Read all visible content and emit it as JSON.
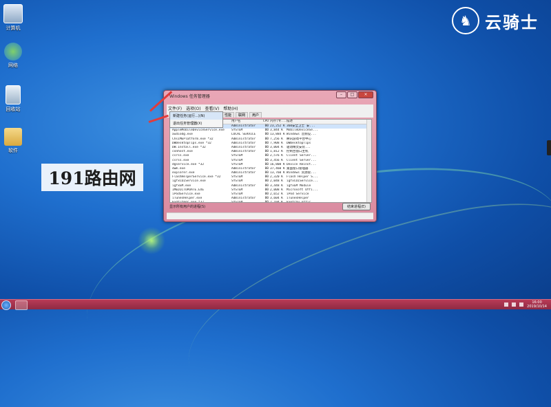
{
  "desktop": {
    "icons": [
      {
        "label": "计算机",
        "icon": "computer-icon"
      },
      {
        "label": "网络",
        "icon": "network-icon"
      },
      {
        "label": "回收站",
        "icon": "recycle-bin-icon"
      },
      {
        "label": "软件",
        "icon": "folder-icon"
      }
    ]
  },
  "brand": {
    "name": "云骑士"
  },
  "watermark": {
    "text": "191路由网"
  },
  "window": {
    "title": "Windows 任务管理器",
    "menu": [
      "文件(F)",
      "选项(O)",
      "查看(V)",
      "帮助(H)"
    ],
    "file_menu": [
      "新建任务(运行...)(N)",
      "退出任务管理器(X)"
    ],
    "tabs": [
      "性能",
      "联网",
      "用户"
    ],
    "columns": [
      "映像名称",
      "用户名",
      "CPU",
      "内存(专...",
      "描述"
    ],
    "processes": [
      {
        "name": "360sd.exe *32",
        "user": "Administrator",
        "cpu": "00",
        "mem": "23,252 K",
        "desc": "360安全卫士 安..."
      },
      {
        "name": "AppleMobileDeviceService.exe",
        "user": "SYSTEM",
        "cpu": "00",
        "mem": "3,844 K",
        "desc": "MobileDeviceSe..."
      },
      {
        "name": "audiodg.exe",
        "user": "LOCAL SERVICE",
        "cpu": "00",
        "mem": "13,884 K",
        "desc": "Windows 音频设..."
      },
      {
        "name": "ChsIMEPlatform.exe *32",
        "user": "Administrator",
        "cpu": "00",
        "mem": "7,256 K",
        "desc": "腾讯游戏平台中心"
      },
      {
        "name": "DWDesktopTips.exe *32",
        "user": "Administrator",
        "cpu": "00",
        "mem": "7,908 K",
        "desc": "DWDesktopTips"
      },
      {
        "name": "DW.Install.exe *32",
        "user": "Administrator",
        "cpu": "00",
        "mem": "3,004 K",
        "desc": "驱动精灵安装..."
      },
      {
        "name": "conhost.exe",
        "user": "Administrator",
        "cpu": "00",
        "mem": "1,812 K",
        "desc": "控制台窗口主机"
      },
      {
        "name": "csrss.exe",
        "user": "SYSTEM",
        "cpu": "00",
        "mem": "2,576 K",
        "desc": "Client Server..."
      },
      {
        "name": "csrss.exe",
        "user": "SYSTEM",
        "cpu": "00",
        "mem": "3,456 K",
        "desc": "Client Server..."
      },
      {
        "name": "dgservice.exe *32",
        "user": "SYSTEM",
        "cpu": "00",
        "mem": "16,808 K",
        "desc": "Device Reinst..."
      },
      {
        "name": "dwm.exe",
        "user": "Administrator",
        "cpu": "00",
        "mem": "37,460 K",
        "desc": "桌面窗口管理器"
      },
      {
        "name": "explorer.exe",
        "user": "Administrator",
        "cpu": "00",
        "mem": "13,760 K",
        "desc": "Windows 资源管..."
      },
      {
        "name": "FlashHelperService.exe *32",
        "user": "SYSTEM",
        "cpu": "00",
        "mem": "2,320 K",
        "desc": "Flash Helper S..."
      },
      {
        "name": "igfxCUIService.exe",
        "user": "SYSTEM",
        "cpu": "00",
        "mem": "2,048 K",
        "desc": "igfxCUIService..."
      },
      {
        "name": "igfxEM.exe",
        "user": "Administrator",
        "cpu": "00",
        "mem": "3,448 K",
        "desc": "igfxEM Module"
      },
      {
        "name": "IMEDICTUPDATE.EXE",
        "user": "SYSTEM",
        "cpu": "00",
        "mem": "2,008 K",
        "desc": "Microsoft Offi..."
      },
      {
        "name": "iPodService.exe",
        "user": "SYSTEM",
        "cpu": "00",
        "mem": "2,652 K",
        "desc": "iPod Service"
      },
      {
        "name": "iTunesHelper.exe",
        "user": "Administrator",
        "cpu": "00",
        "mem": "3,604 K",
        "desc": "iTunesHelper"
      },
      {
        "name": "kxdfltmgr.exe *32",
        "user": "SYSTEM",
        "cpu": "00",
        "mem": "2,104 K",
        "desc": "kxetray.offic..."
      }
    ],
    "show_all_label": "显示所有用户的进程(S)",
    "end_process_label": "结束进程(E)"
  },
  "taskbar": {
    "time": "16:00",
    "date": "2019/10/14"
  },
  "colors": {
    "annotation_arrow": "#e23b3b",
    "taskbar": "#b83a56"
  }
}
